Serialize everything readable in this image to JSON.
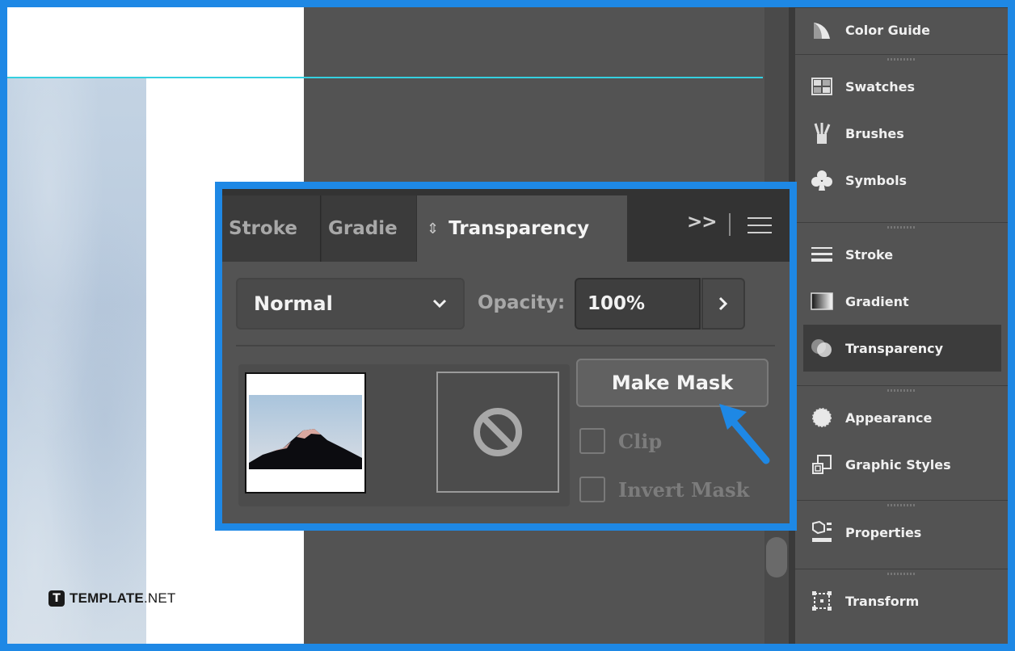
{
  "dock": {
    "items": [
      {
        "label": "Color Guide",
        "icon": "color-guide-icon"
      },
      {
        "label": "Swatches",
        "icon": "swatches-icon"
      },
      {
        "label": "Brushes",
        "icon": "brushes-icon"
      },
      {
        "label": "Symbols",
        "icon": "symbols-icon"
      },
      {
        "label": "Stroke",
        "icon": "stroke-icon"
      },
      {
        "label": "Gradient",
        "icon": "gradient-icon"
      },
      {
        "label": "Transparency",
        "icon": "transparency-icon",
        "active": true
      },
      {
        "label": "Appearance",
        "icon": "appearance-icon"
      },
      {
        "label": "Graphic Styles",
        "icon": "graphic-styles-icon"
      },
      {
        "label": "Properties",
        "icon": "properties-icon"
      },
      {
        "label": "Transform",
        "icon": "transform-icon"
      }
    ]
  },
  "panel": {
    "tabs": {
      "stroke": "Stroke",
      "gradient": "Gradie",
      "transparency": "Transparency"
    },
    "collapse_label": ">>",
    "blend_mode": "Normal",
    "opacity_label": "Opacity:",
    "opacity_value": "100%",
    "make_mask_label": "Make Mask",
    "clip_label": "Clip",
    "invert_mask_label": "Invert Mask"
  },
  "watermark": {
    "logo_letter": "T",
    "brand_bold": "TEMPLATE",
    "brand_suffix": ".NET"
  },
  "colors": {
    "highlight_border": "#1e88e5",
    "guide": "#35d0e0",
    "panel_bg": "#535353"
  }
}
